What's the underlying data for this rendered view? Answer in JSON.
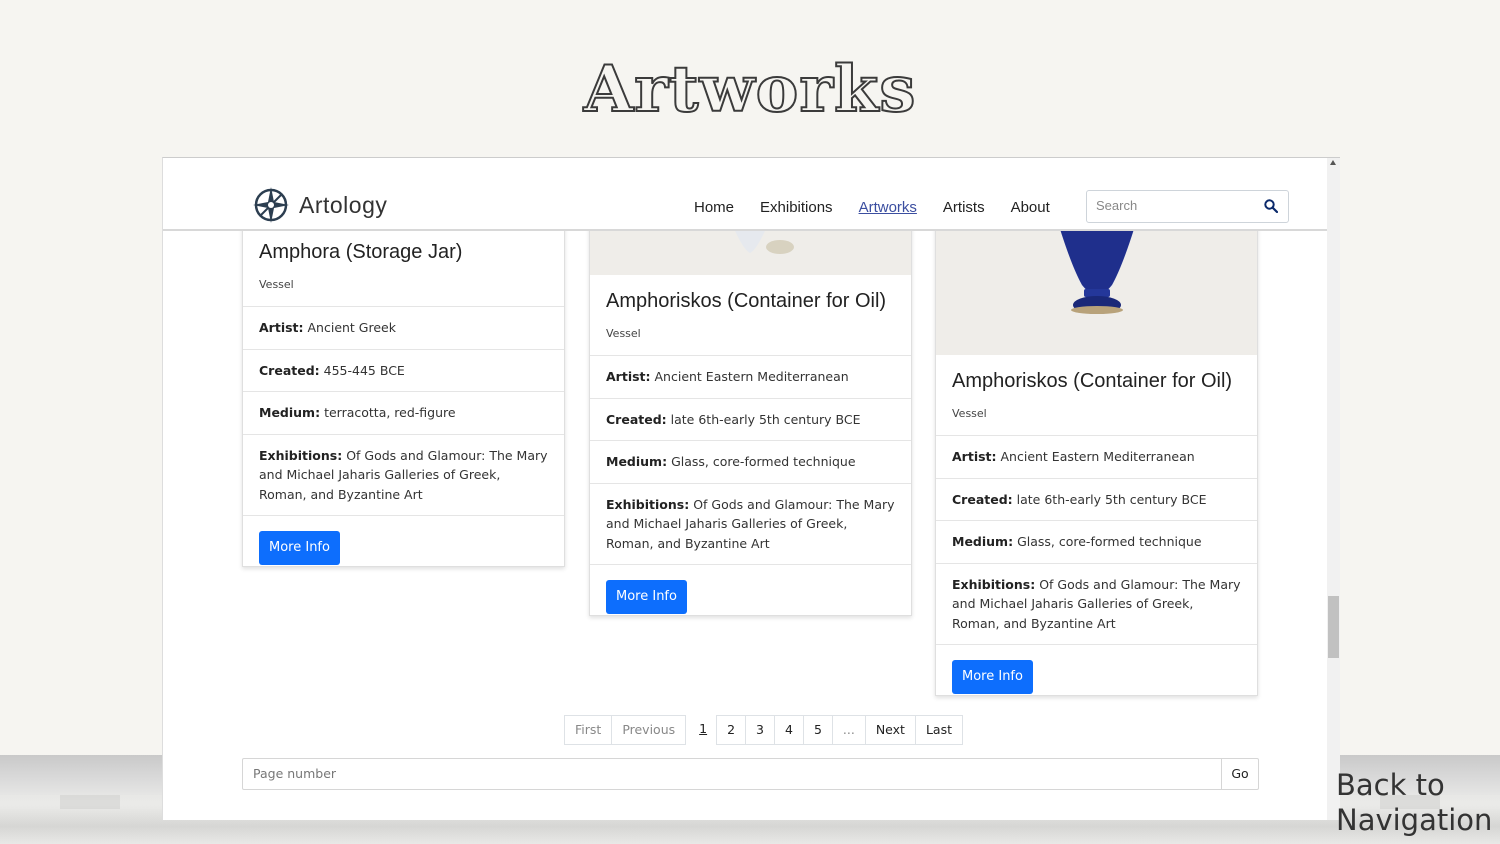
{
  "page": {
    "title": "Artworks",
    "back_nav": "Back to Navigation"
  },
  "navbar": {
    "brand": "Artology",
    "links": [
      "Home",
      "Exhibitions",
      "Artworks",
      "Artists",
      "About"
    ],
    "active": "Artworks",
    "search_placeholder": "Search"
  },
  "cards": [
    {
      "title": "Amphora (Storage Jar)",
      "type": "Vessel",
      "artist_label": "Artist:",
      "artist": "Ancient Greek",
      "created_label": "Created:",
      "created": "455-445 BCE",
      "medium_label": "Medium:",
      "medium": "terracotta, red-figure",
      "exhibitions_label": "Exhibitions:",
      "exhibitions": "Of Gods and Glamour: The Mary and Michael Jaharis Galleries of Greek, Roman, and Byzantine Art",
      "button": "More Info"
    },
    {
      "title": "Amphoriskos (Container for Oil)",
      "type": "Vessel",
      "artist_label": "Artist:",
      "artist": "Ancient Eastern Mediterranean",
      "created_label": "Created:",
      "created": "late 6th-early 5th century BCE",
      "medium_label": "Medium:",
      "medium": "Glass, core-formed technique",
      "exhibitions_label": "Exhibitions:",
      "exhibitions": "Of Gods and Glamour: The Mary and Michael Jaharis Galleries of Greek, Roman, and Byzantine Art",
      "button": "More Info"
    },
    {
      "title": "Amphoriskos (Container for Oil)",
      "type": "Vessel",
      "artist_label": "Artist:",
      "artist": "Ancient Eastern Mediterranean",
      "created_label": "Created:",
      "created": "late 6th-early 5th century BCE",
      "medium_label": "Medium:",
      "medium": "Glass, core-formed technique",
      "exhibitions_label": "Exhibitions:",
      "exhibitions": "Of Gods and Glamour: The Mary and Michael Jaharis Galleries of Greek, Roman, and Byzantine Art",
      "button": "More Info"
    }
  ],
  "pagination": {
    "first": "First",
    "previous": "Previous",
    "pages": [
      "1",
      "2",
      "3",
      "4",
      "5"
    ],
    "current": "1",
    "ellipsis": "...",
    "next": "Next",
    "last": "Last"
  },
  "page_form": {
    "placeholder": "Page number",
    "go": "Go"
  },
  "colors": {
    "primary_button": "#0d6efd",
    "active_link": "#3b4ea0",
    "vase_blue": "#1f2f8c"
  }
}
